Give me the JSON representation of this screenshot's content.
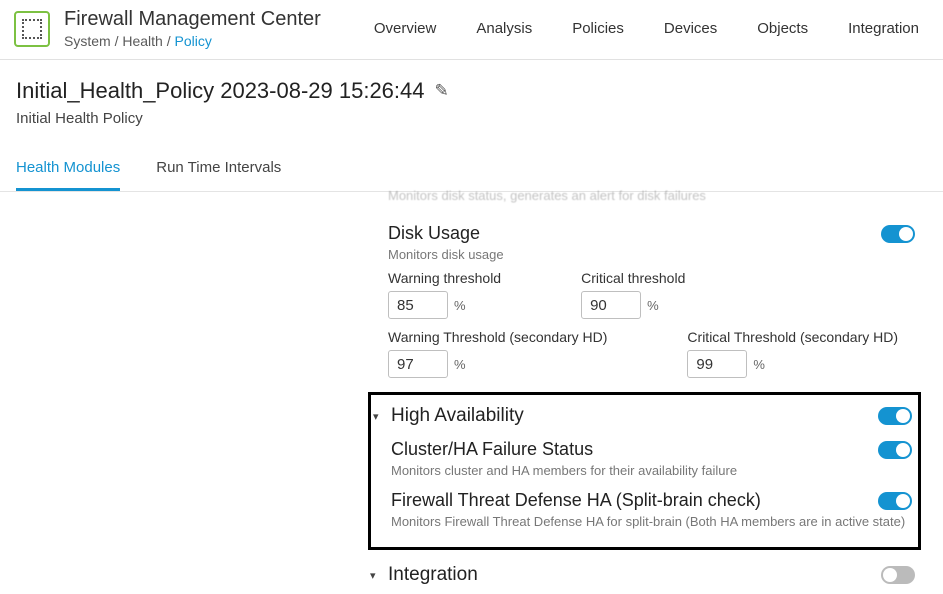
{
  "brand": {
    "title": "Firewall Management Center",
    "breadcrumb_system": "System",
    "breadcrumb_health": "Health",
    "breadcrumb_policy": "Policy"
  },
  "nav": {
    "overview": "Overview",
    "analysis": "Analysis",
    "policies": "Policies",
    "devices": "Devices",
    "objects": "Objects",
    "integration": "Integration"
  },
  "page": {
    "title": "Initial_Health_Policy 2023-08-29 15:26:44",
    "subtitle": "Initial Health Policy"
  },
  "tabs": {
    "health_modules": "Health Modules",
    "run_time_intervals": "Run Time Intervals"
  },
  "cutoff_module": {
    "desc": "Monitors disk status, generates an alert for disk failures"
  },
  "disk_usage": {
    "title": "Disk Usage",
    "desc": "Monitors disk usage",
    "warn_label": "Warning threshold",
    "warn_value": "85",
    "crit_label": "Critical threshold",
    "crit_value": "90",
    "warn2_label": "Warning Threshold (secondary HD)",
    "warn2_value": "97",
    "crit2_label": "Critical Threshold (secondary HD)",
    "crit2_value": "99",
    "pct": "%"
  },
  "ha": {
    "section_title": "High Availability",
    "cluster": {
      "title": "Cluster/HA Failure Status",
      "desc": "Monitors cluster and HA members for their availability failure"
    },
    "splitbrain": {
      "title": "Firewall Threat Defense HA (Split-brain check)",
      "desc": "Monitors Firewall Threat Defense HA for split-brain (Both HA members are in active state)"
    }
  },
  "integration": {
    "section_title": "Integration"
  }
}
